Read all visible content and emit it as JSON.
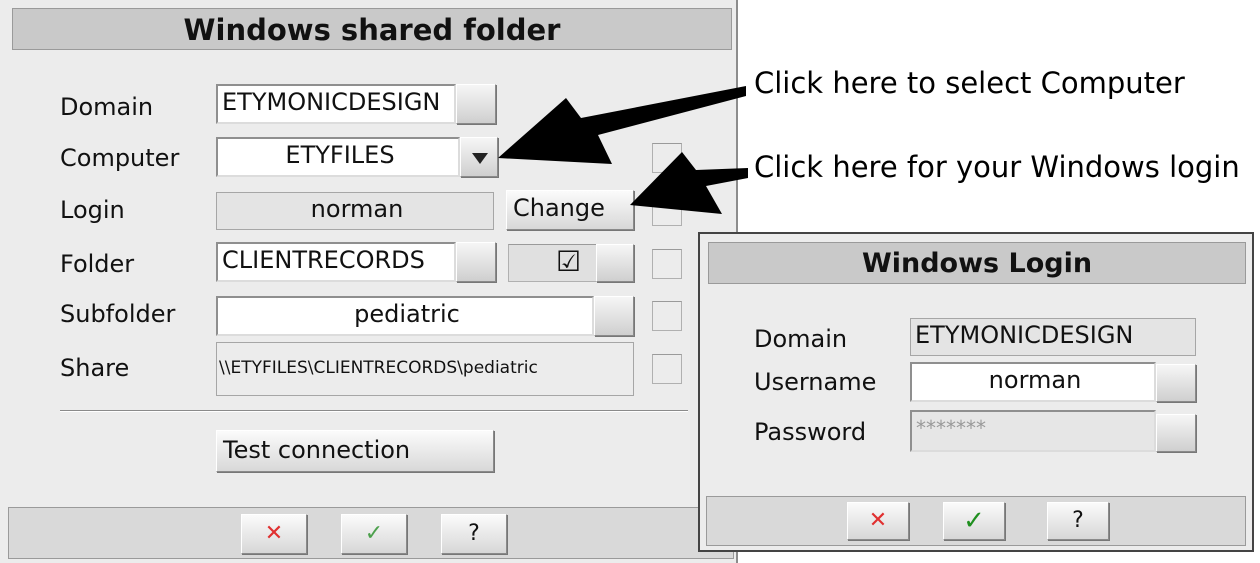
{
  "main": {
    "title": "Windows shared folder",
    "labels": {
      "domain": "Domain",
      "computer": "Computer",
      "login": "Login",
      "folder": "Folder",
      "subfolder": "Subfolder",
      "share": "Share"
    },
    "values": {
      "domain": "ETYMONICDESIGN",
      "computer": "ETYFILES",
      "login": "norman",
      "folder": "CLIENTRECORDS",
      "subfolder": "pediatric",
      "share": "\\\\ETYFILES\\CLIENTRECORDS\\pediatric"
    },
    "change_label": "Change",
    "folder_check": "☑",
    "test_connection_label": "Test connection",
    "footer": {
      "cancel": "✕",
      "ok": "✓",
      "help": "?"
    }
  },
  "annotations": {
    "computer_hint": "Click here to select Computer",
    "login_hint": "Click here for your Windows login"
  },
  "login": {
    "title": "Windows Login",
    "labels": {
      "domain": "Domain",
      "username": "Username",
      "password": "Password"
    },
    "values": {
      "domain": "ETYMONICDESIGN",
      "username": "norman",
      "password": "*******"
    },
    "footer": {
      "cancel": "✕",
      "ok": "✓",
      "help": "?"
    }
  },
  "colors": {
    "cancel": "#e03030",
    "ok_main": "#4ca04c",
    "ok_login": "#1f8f1f"
  },
  "icons": {
    "dropdown": "chevron-down-icon",
    "cancel": "close-icon",
    "ok": "checkmark-icon",
    "help": "help-icon"
  }
}
